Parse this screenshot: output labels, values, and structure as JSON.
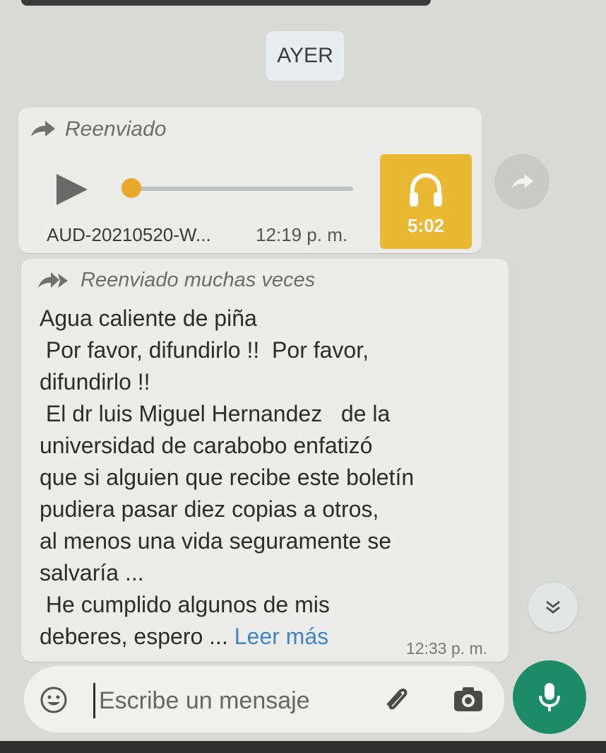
{
  "date_separator": "AYER",
  "audio_message": {
    "forwarded_label": "Reenviado",
    "file_name": "AUD-20210520-W...",
    "time": "12:19 p. m.",
    "duration": "5:02",
    "progress": 0.0,
    "accent_color": "#e9b933"
  },
  "text_message": {
    "forwarded_label": "Reenviado muchas veces",
    "lines": [
      "Agua caliente de piña",
      " Por favor, difundirlo !!  Por favor,",
      "difundirlo !!",
      " El dr luis Miguel Hernandez   de la",
      "universidad de carabobo enfatizó",
      "que si alguien que recibe este boletín",
      "pudiera pasar diez copias a otros,",
      "al menos una vida seguramente se",
      "salvaría ...",
      " He cumplido algunos de mis"
    ],
    "last_line_prefix": "deberes, espero ... ",
    "read_more": "Leer más",
    "time": "12:33 p. m."
  },
  "composer": {
    "placeholder": "Escribe un mensaje"
  },
  "icons": {
    "forward": "forward-icon",
    "forwarded_many": "double-forward-icon",
    "play": "play-icon",
    "headphones": "headphones-icon",
    "share": "share-icon",
    "scroll_down": "double-chevron-down-icon",
    "emoji": "emoji-icon",
    "attach": "paperclip-icon",
    "camera": "camera-icon",
    "mic": "microphone-icon"
  },
  "colors": {
    "mic_button": "#1b8c67",
    "link": "#3e86c9"
  }
}
